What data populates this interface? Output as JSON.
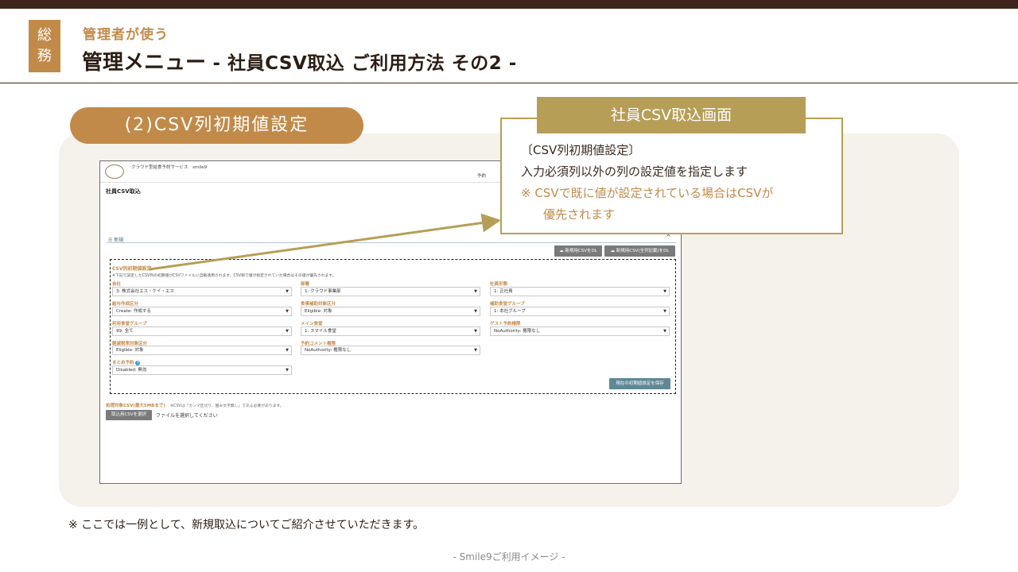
{
  "header": {
    "dept_char1": "総",
    "dept_char2": "務",
    "subtitle": "管理者が使う",
    "title_main": "管理メニュー",
    "title_rest": " - 社員CSV取込 ご利用方法 その2 -"
  },
  "section_pill": "(2)CSV列初期値設定",
  "callout": {
    "title": "社員CSV取込画面",
    "line1": "〔CSV列初期値設定〕",
    "line2": "入力必須列以外の列の設定値を指定します",
    "line3": "※ CSVで既に値が設定されている場合はCSVが",
    "line4": "優先されます"
  },
  "screenshot": {
    "service_name": "クラウド型給食予約サービス　smile9",
    "menu_item": "予約",
    "page_title": "社員CSV取込",
    "section_title": "新規",
    "caret": "^",
    "download_button_1": "新規用CSVをDL",
    "download_button_2": "新規用CSV(全列記載)をDL",
    "csv_init_title": "CSV列初期値設定",
    "csv_init_note": "※下記で設定したCSV列の初期値がCSVファイルに自動適用されます。CSV側で値が指定されていた場合はその値が優先されます。",
    "fields": [
      {
        "label": "会社",
        "value": "3: 株式会社エス・ケイ・エス"
      },
      {
        "label": "部署",
        "value": "1: クラウド事業部"
      },
      {
        "label": "社員形態",
        "value": "1: 正社員"
      },
      {
        "label": "給与作成区分",
        "value": "Create: 作成する"
      },
      {
        "label": "食事補助対象区分",
        "value": "Eligible: 対象"
      },
      {
        "label": "補助食堂グループ",
        "value": "1: 本社グループ"
      },
      {
        "label": "利用食堂グループ",
        "value": "99: 全て"
      },
      {
        "label": "メイン食堂",
        "value": "1: スマイル食堂"
      },
      {
        "label": "ゲスト予約権限",
        "value": "NoAuthority: 権限なし"
      },
      {
        "label": "軽減税率対象区分",
        "value": "Eligible: 対象"
      },
      {
        "label": "予約コメント権限",
        "value": "NoAuthority: 権限なし"
      },
      {
        "label": "まとめ予約",
        "value": "Disabled: 無効"
      }
    ],
    "save_button": "現在の初期値設定を保存",
    "target_label": "処理対象CSV(最大5MBまで)",
    "target_note": "※CSVは「カンマ区切り、囲み文字無し」である必要があります。",
    "file_button": "取込用CSVを選択",
    "file_placeholder": "ファイルを選択してください"
  },
  "footnote": "※ ここでは一例として、新規取込についてご紹介させていただきます。",
  "footer": "- Smile9ご利用イメージ -",
  "colors": {
    "brand_brown": "#3f241c",
    "accent_orange": "#c28a49",
    "callout_gold": "#b79e57",
    "panel_bg": "#f5f1eb"
  }
}
